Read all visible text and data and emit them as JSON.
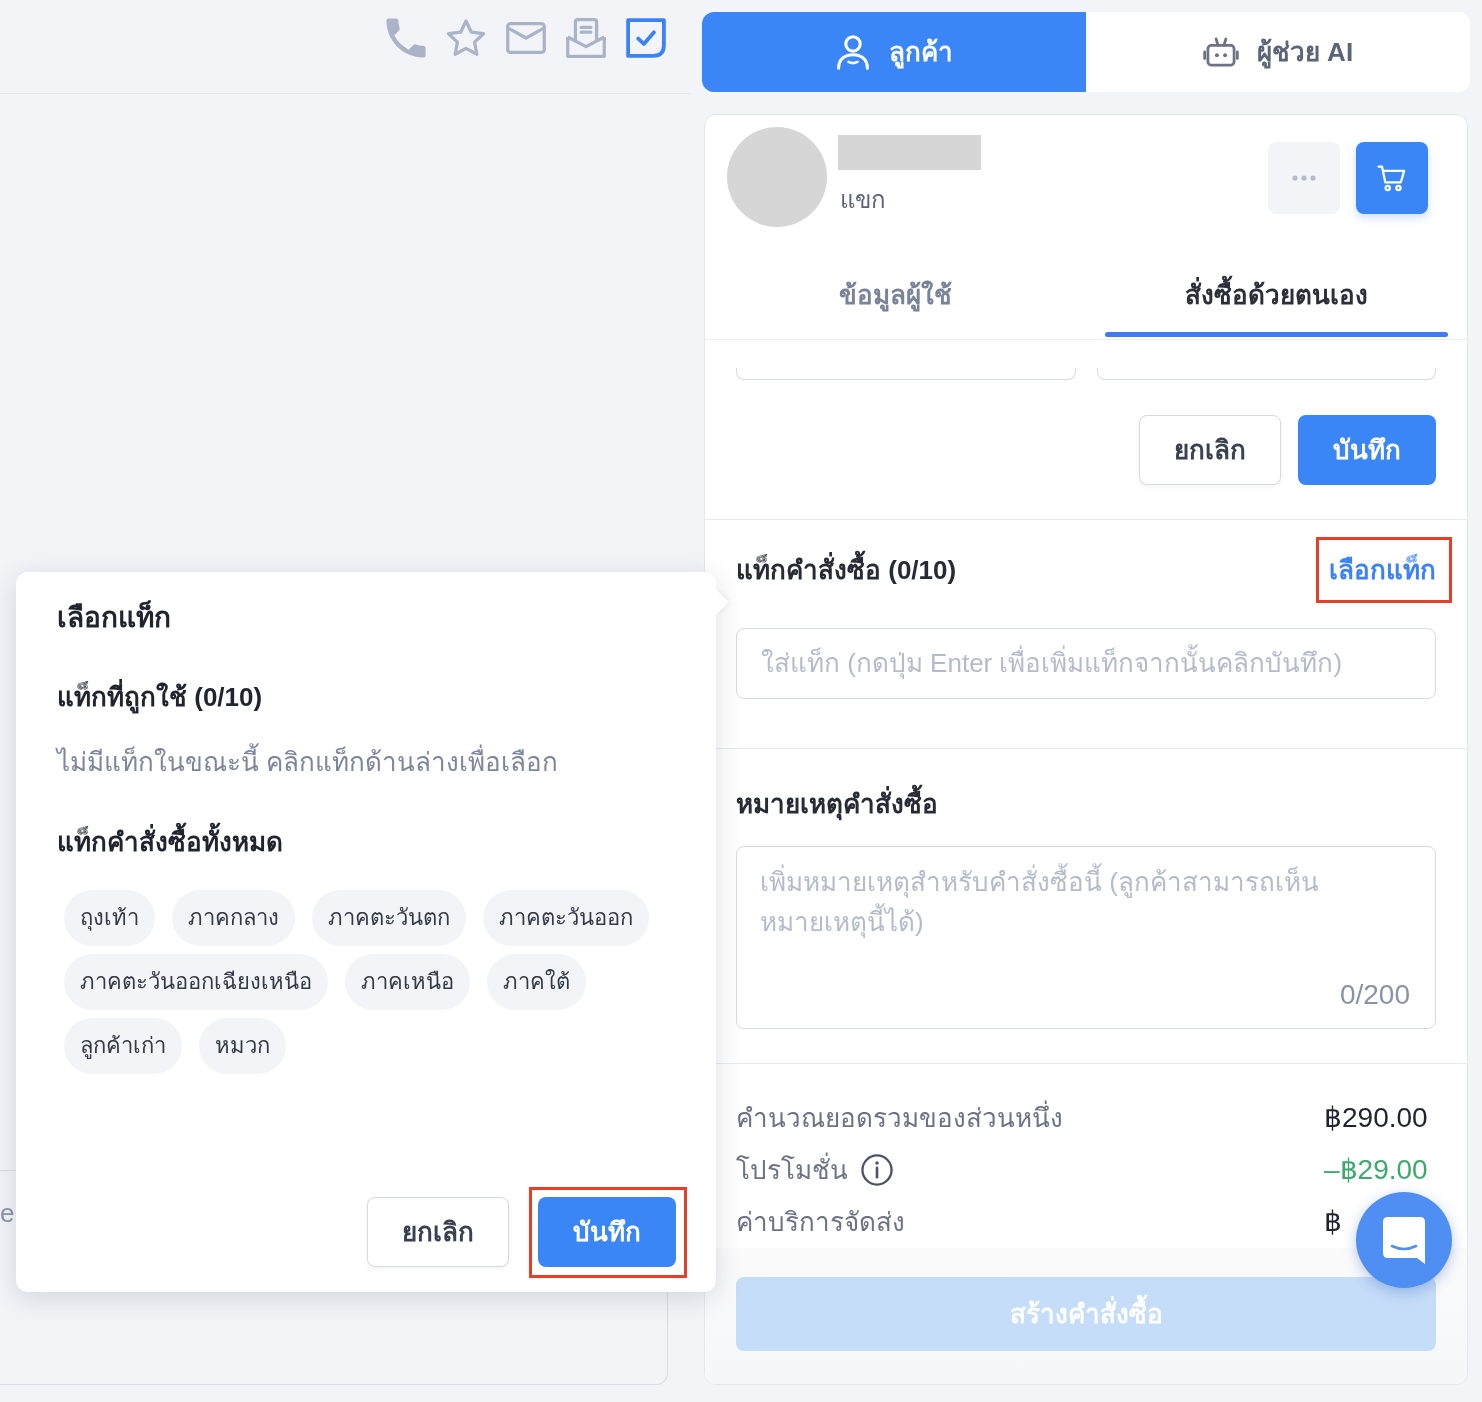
{
  "toolbar": [
    {
      "kind": "phone",
      "selected": false
    },
    {
      "kind": "star",
      "selected": false
    },
    {
      "kind": "mail",
      "selected": false
    },
    {
      "kind": "letter",
      "selected": false
    },
    {
      "kind": "task",
      "selected": true
    }
  ],
  "composer": {
    "placeholder": "e"
  },
  "tag_popover": {
    "title": "เลือกแท็ก",
    "used_heading": "แท็กที่ถูกใช้ (0/10)",
    "empty_text": "ไม่มีแท็กในขณะนี้ คลิกแท็กด้านล่างเพื่อเลือก",
    "all_heading": "แท็กคำสั่งซื้อทั้งหมด",
    "tags": [
      {
        "label": "ถุงเท้า",
        "selected": false
      },
      {
        "label": "ภาคกลาง",
        "selected": false
      },
      {
        "label": "ภาคตะวันตก",
        "selected": false
      },
      {
        "label": "ภาคตะวันออก",
        "selected": false
      },
      {
        "label": "ภาคตะวันออกเฉียงเหนือ",
        "selected": false
      },
      {
        "label": "ภาคเหนือ",
        "selected": false
      },
      {
        "label": "ภาคใต้",
        "selected": false
      },
      {
        "label": "ลูกค้าเก่า",
        "selected": false
      },
      {
        "label": "หมวก",
        "selected": false
      }
    ],
    "buttons": [
      {
        "label": "ยกเลิก",
        "kind": "secondary",
        "highlighted": false
      },
      {
        "label": "บันทึก",
        "kind": "primary",
        "highlighted": true
      }
    ]
  },
  "panel_tabs": [
    {
      "label": "ลูกค้า",
      "kind": "customer",
      "selected": true
    },
    {
      "label": "ผู้ช่วย AI",
      "kind": "assistant",
      "selected": false
    }
  ],
  "customer": {
    "type": "แขก"
  },
  "customer_tabs": [
    {
      "label": "ข้อมูลผู้ใช้",
      "selected": false
    },
    {
      "label": "สั่งซื้อด้วยตนเอง",
      "selected": true
    }
  ],
  "edit_buttons": [
    {
      "label": "ยกเลิก",
      "kind": "secondary",
      "highlighted": false
    },
    {
      "label": "บันทึก",
      "kind": "primary",
      "highlighted": false
    }
  ],
  "order_tags": {
    "title": "แท็กคำสั่งซื้อ (0/10)",
    "link": {
      "label": "เลือกแท็ก",
      "highlighted": true
    },
    "input": {
      "placeholder": "ใส่แท็ก (กดปุ่ม Enter เพื่อเพิ่มแท็กจากนั้นคลิกบันทึก)"
    }
  },
  "order_note": {
    "title": "หมายเหตุคำสั่งซื้อ",
    "placeholder": "เพิ่มหมายเหตุสำหรับคำสั่งซื้อนี้ (ลูกค้าสามารถเห็นหมายเหตุนี้ได้)",
    "counter": "0/200"
  },
  "summary": [
    {
      "label": "คำนวณยอดรวมของส่วนหนึ่ง",
      "value": "฿290.00",
      "kind": "amount"
    },
    {
      "label": "โปรโมชั่น",
      "value": "–฿29.00",
      "kind": "discount",
      "info": true
    },
    {
      "label": "ค่าบริการจัดส่ง",
      "value": "฿",
      "kind": "amount"
    }
  ],
  "create_order_button": {
    "label": "สร้างคำสั่งซื้อ",
    "disabled": true
  }
}
